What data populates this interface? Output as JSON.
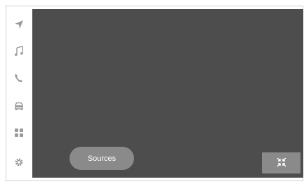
{
  "sidebar": {
    "items": [
      {
        "icon": "navigation-arrow-icon"
      },
      {
        "icon": "music-note-icon"
      },
      {
        "icon": "phone-icon"
      },
      {
        "icon": "car-icon"
      },
      {
        "icon": "apps-grid-icon"
      },
      {
        "icon": "gear-icon"
      }
    ]
  },
  "main": {
    "sources_label": "Sources",
    "shrink_icon": "minimize-arrows-icon"
  },
  "colors": {
    "screen_bg": "#4d4d4d",
    "button_bg": "#8a8a8a",
    "sidebar_icon": "#9a9a9a"
  }
}
